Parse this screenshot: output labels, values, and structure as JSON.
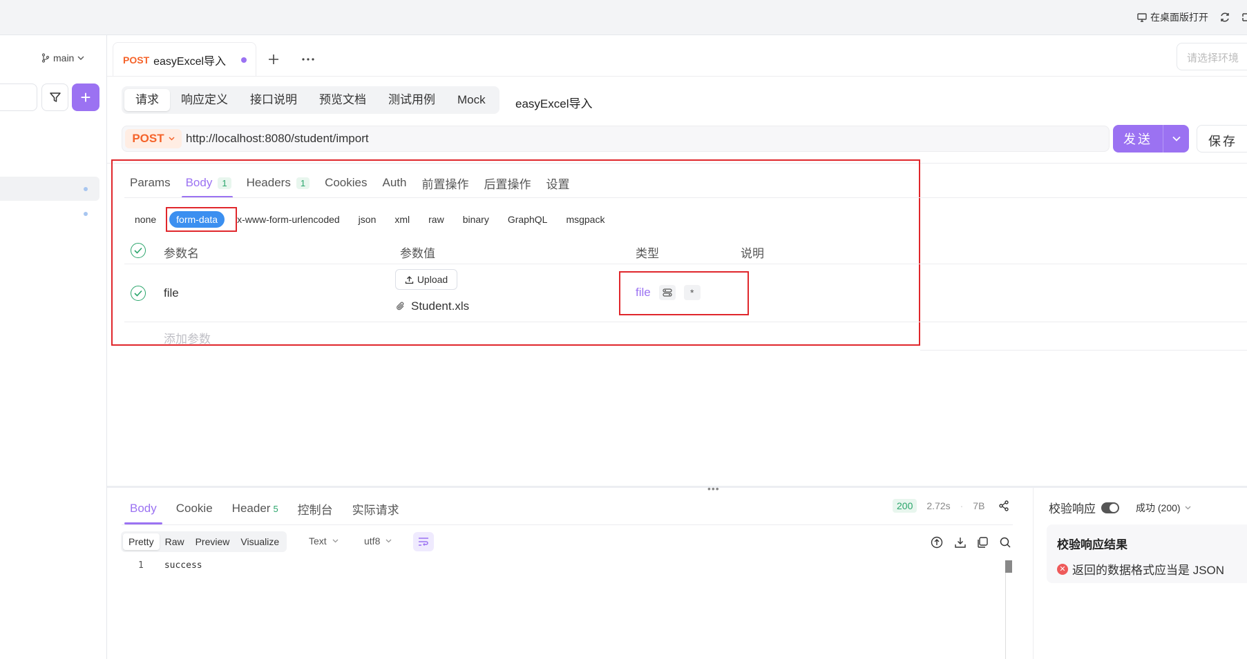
{
  "topbar": {
    "open_desktop": "在桌面版打开"
  },
  "sidebar": {
    "branch": "main"
  },
  "tab": {
    "method": "POST",
    "title": "easyExcel导入"
  },
  "env": {
    "placeholder": "请选择环境"
  },
  "subnav": {
    "items": [
      "请求",
      "响应定义",
      "接口说明",
      "预览文档",
      "测试用例",
      "Mock"
    ],
    "api_name": "easyExcel导入"
  },
  "url": {
    "method": "POST",
    "value": "http://localhost:8080/student/import"
  },
  "buttons": {
    "send": "发送",
    "save": "保存"
  },
  "request_tabs": [
    {
      "label": "Params"
    },
    {
      "label": "Body",
      "count": "1"
    },
    {
      "label": "Headers",
      "count": "1"
    },
    {
      "label": "Cookies"
    },
    {
      "label": "Auth"
    },
    {
      "label": "前置操作"
    },
    {
      "label": "后置操作"
    },
    {
      "label": "设置"
    }
  ],
  "body_types": [
    "none",
    "form-data",
    "x-www-form-urlencoded",
    "json",
    "xml",
    "raw",
    "binary",
    "GraphQL",
    "msgpack"
  ],
  "params_table": {
    "headers": [
      "参数名",
      "参数值",
      "类型",
      "说明"
    ],
    "rows": [
      {
        "name": "file",
        "upload_label": "Upload",
        "file_name": "Student.xls",
        "type": "file",
        "required_mark": "*"
      }
    ],
    "add_placeholder": "添加参数"
  },
  "response": {
    "tabs": [
      {
        "label": "Body"
      },
      {
        "label": "Cookie"
      },
      {
        "label": "Header",
        "count": "5"
      },
      {
        "label": "控制台"
      },
      {
        "label": "实际请求"
      }
    ],
    "status": "200",
    "time": "2.72s",
    "size": "7B",
    "formats": [
      "Pretty",
      "Raw",
      "Preview",
      "Visualize"
    ],
    "content_type": "Text",
    "encoding": "utf8",
    "code_lines": [
      {
        "num": "1",
        "text": "success"
      }
    ]
  },
  "validation": {
    "label": "校验响应",
    "status_option": "成功 (200)",
    "result_title": "校验响应结果",
    "error": "返回的数据格式应当是 JSON"
  },
  "colors": {
    "accent": "#9b72f2",
    "post": "#f5632a",
    "success": "#2aa56b",
    "highlight": "#e0262b",
    "form_data": "#3b8ff0"
  }
}
